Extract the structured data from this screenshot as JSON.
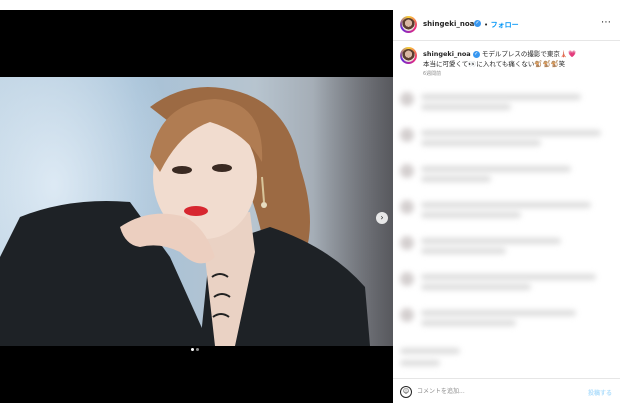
{
  "header": {
    "username": "shingeki_noa",
    "separator": "•",
    "follow_label": "フォロー",
    "more_icon": "⋯"
  },
  "caption": {
    "username": "shingeki_noa",
    "line1": "モデルプレスの撮影で東京🗼💗",
    "line2": "本当に可愛くて👀に入れても痛くない🐒🐒🐒笑",
    "time": "6週間前"
  },
  "media": {
    "next_icon": "›",
    "dots": [
      {
        "active": true,
        "color": "#ffffff"
      },
      {
        "active": false,
        "color": "#8a8a8a"
      }
    ]
  },
  "comment": {
    "placeholder": "コメントを追加...",
    "post_label": "投稿する",
    "emoji_icon": "☺"
  },
  "colors": {
    "accent": "#0095f6",
    "verified": "#3897f0",
    "post_disabled": "#b2dffc"
  }
}
